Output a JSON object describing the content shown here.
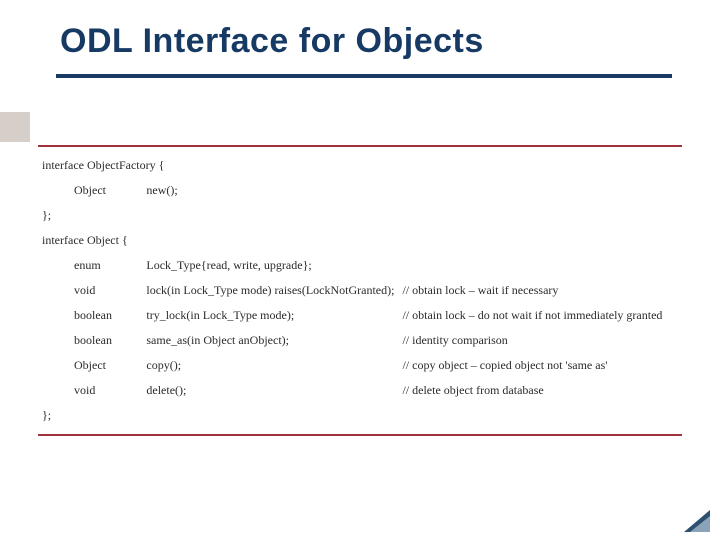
{
  "title": "ODL Interface for Objects",
  "code": {
    "iface1_open": "interface ObjectFactory {",
    "r1_type": "Object",
    "r1_sig": "new();",
    "iface1_close": "};",
    "iface2_open": "interface Object {",
    "r2_type": "enum",
    "r2_sig": "Lock_Type{read, write, upgrade};",
    "r3_type": "void",
    "r3_sig": "lock(in Lock_Type mode) raises(LockNotGranted);",
    "r3_note": "// obtain lock – wait if necessary",
    "r4_type": "boolean",
    "r4_sig": "try_lock(in Lock_Type mode);",
    "r4_note": "// obtain lock – do not wait if not immediately granted",
    "r5_type": "boolean",
    "r5_sig": "same_as(in Object anObject);",
    "r5_note": "// identity comparison",
    "r6_type": "Object",
    "r6_sig": "copy();",
    "r6_note": "// copy object – copied object not 'same as'",
    "r7_type": "void",
    "r7_sig": "delete();",
    "r7_note": "// delete object from database",
    "iface2_close": "};"
  }
}
